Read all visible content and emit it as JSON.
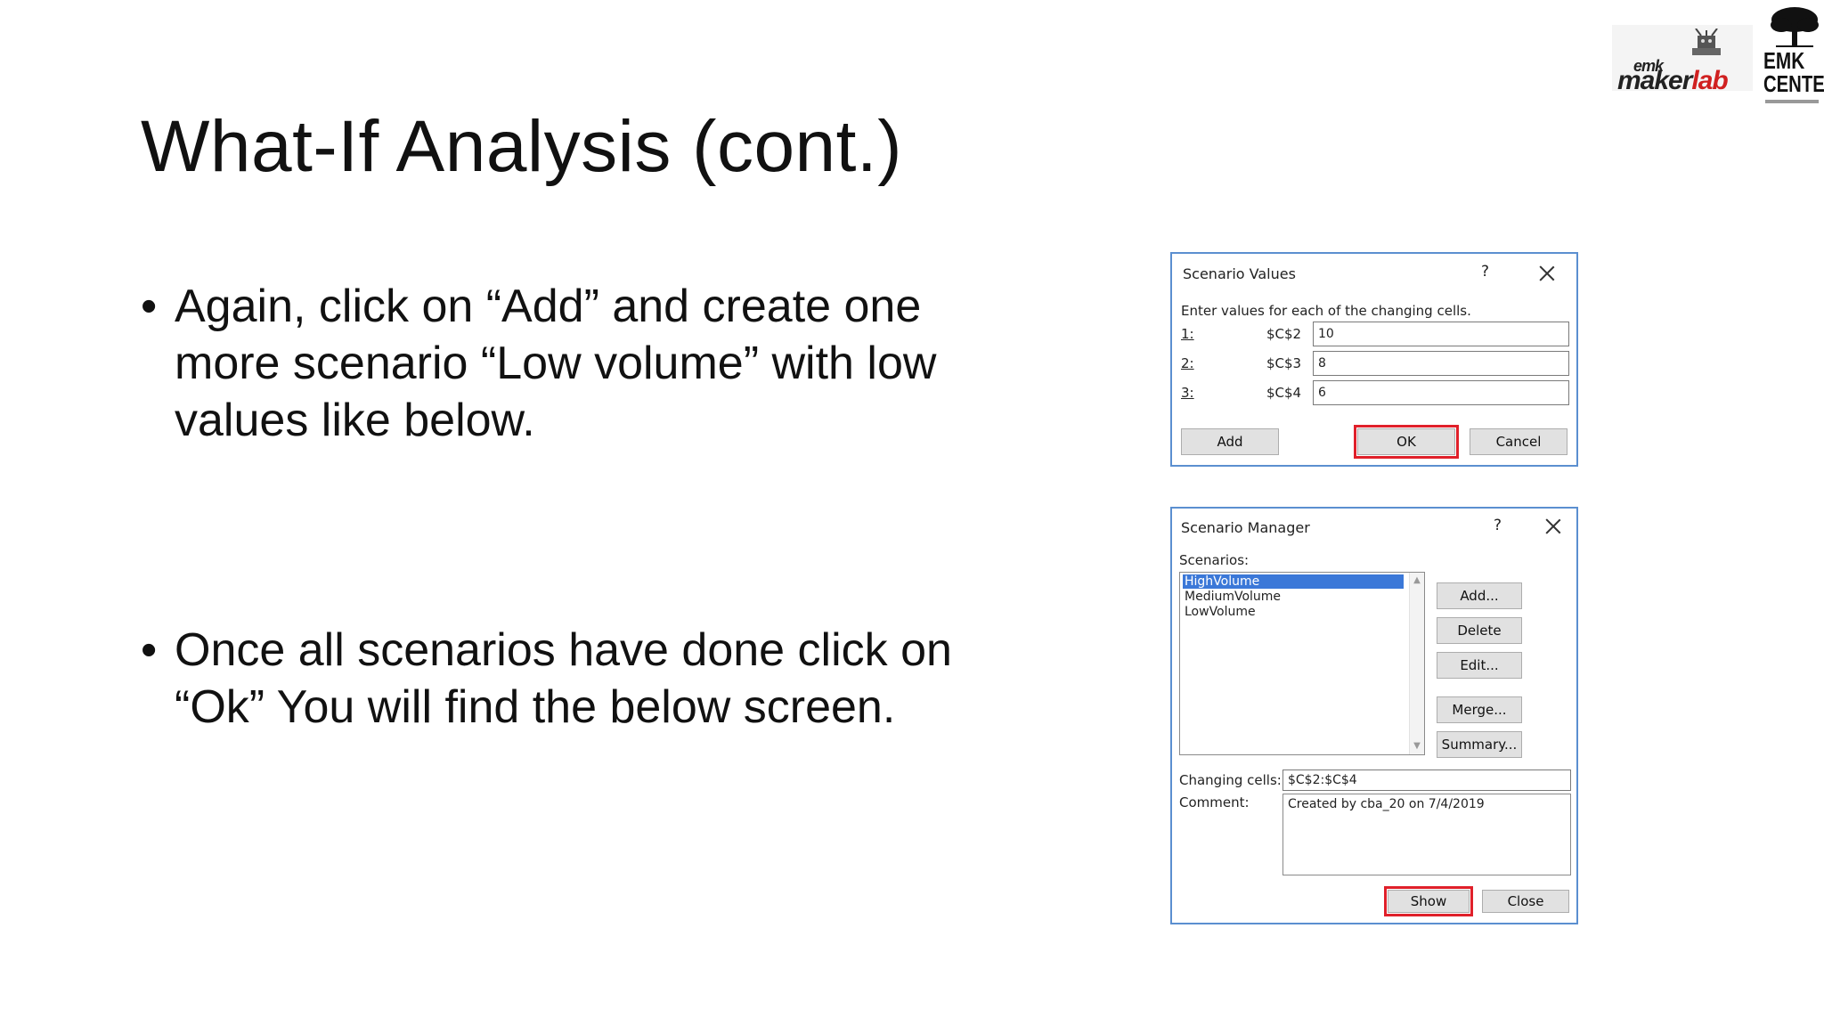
{
  "slide": {
    "title": "What-If Analysis (cont.)",
    "bullets": [
      {
        "marker": "•",
        "text": "Again, click on “Add” and create one more scenario “Low volume” with low values like below."
      },
      {
        "marker": "•",
        "text": "Once all scenarios have done click on “Ok” You will find the below screen."
      }
    ]
  },
  "logos": {
    "makerlab": {
      "text_top": "emk",
      "text_main": "maker",
      "text_accent": "lab"
    },
    "emk": {
      "line1": "EMK",
      "line2": "CENTER"
    }
  },
  "scenario_values_dialog": {
    "title": "Scenario Values",
    "help": "?",
    "instructions": "Enter values for each of the changing cells.",
    "rows": [
      {
        "index": "1:",
        "ref": "$C$2",
        "value": "10"
      },
      {
        "index": "2:",
        "ref": "$C$3",
        "value": "8"
      },
      {
        "index": "3:",
        "ref": "$C$4",
        "value": "6"
      }
    ],
    "buttons": {
      "add": "Add",
      "ok": "OK",
      "cancel": "Cancel"
    }
  },
  "scenario_manager_dialog": {
    "title": "Scenario Manager",
    "help": "?",
    "scenarios_label": "Scenarios:",
    "scenarios": [
      "HighVolume",
      "MediumVolume",
      "LowVolume"
    ],
    "selected_scenario": "HighVolume",
    "buttons": {
      "add": "Add...",
      "delete": "Delete",
      "edit": "Edit...",
      "merge": "Merge...",
      "summary": "Summary...",
      "show": "Show",
      "close": "Close"
    },
    "changing_cells_label": "Changing cells:",
    "changing_cells": "$C$2:$C$4",
    "comment_label": "Comment:",
    "comment": "Created by cba_20 on 7/4/2019"
  },
  "colors": {
    "dialog_border": "#5b8fd0",
    "highlight": "#e0202a",
    "selection": "#3b78d8"
  }
}
